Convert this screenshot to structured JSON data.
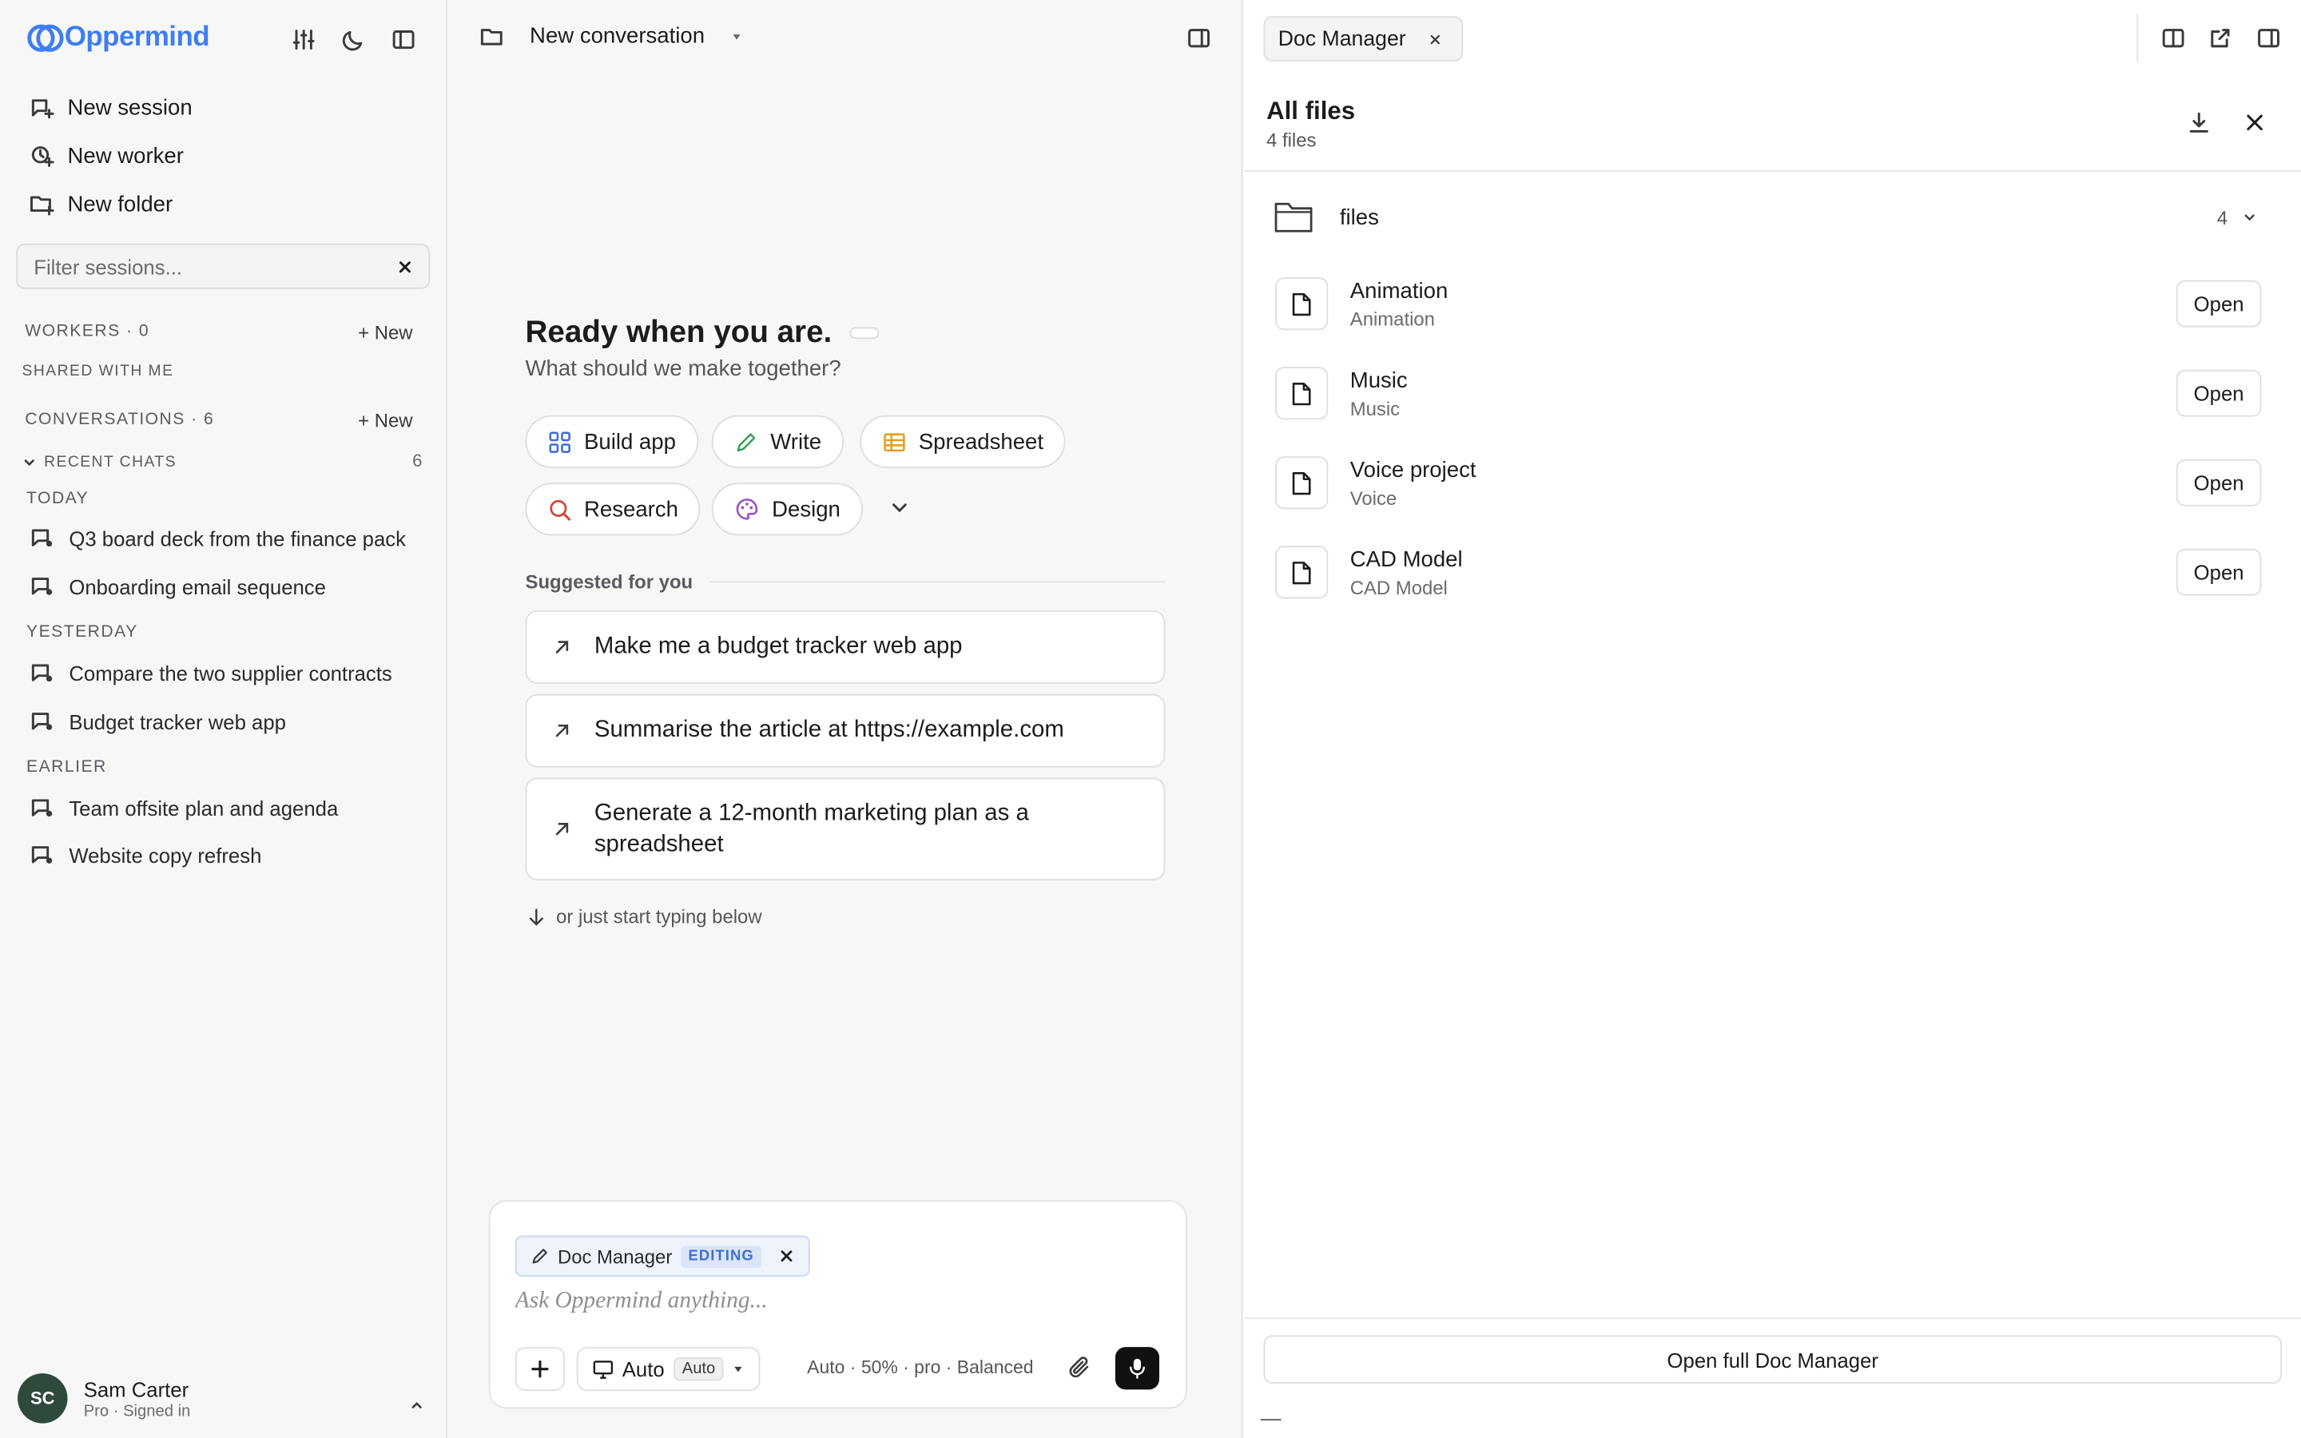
{
  "app": {
    "name": "Oppermind",
    "brand_color": "#3d7ef0"
  },
  "sidebar": {
    "actions": [
      {
        "label": "New session",
        "icon": "new-session-icon"
      },
      {
        "label": "New worker",
        "icon": "new-worker-icon"
      },
      {
        "label": "New folder",
        "icon": "new-folder-icon"
      }
    ],
    "filter_placeholder": "Filter sessions...",
    "workers_label": "WORKERS · 0",
    "workers_new": "+ New",
    "shared_label": "SHARED WITH ME",
    "conversations_label": "CONVERSATIONS · 6",
    "conversations_new": "+ New",
    "recent_label": "RECENT CHATS",
    "recent_count": "6",
    "groups": [
      {
        "label": "TODAY",
        "items": [
          "Q3 board deck from the finance pack",
          "Onboarding email sequence"
        ]
      },
      {
        "label": "YESTERDAY",
        "items": [
          "Compare the two supplier contracts",
          "Budget tracker web app"
        ]
      },
      {
        "label": "EARLIER",
        "items": [
          "Team offsite plan and agenda",
          "Website copy refresh"
        ]
      }
    ],
    "user": {
      "initials": "SC",
      "name": "Sam Carter",
      "status": "Pro · Signed in",
      "avatar_color": "#2f4a3c"
    }
  },
  "center": {
    "title": "New conversation",
    "hero_title": "Ready when you are.",
    "hero_sub": "What should we make together?",
    "chips": [
      {
        "label": "Build app",
        "icon": "grid-icon",
        "color": "#3d6fd6"
      },
      {
        "label": "Write",
        "icon": "pencil-icon",
        "color": "#3aa35a"
      },
      {
        "label": "Spreadsheet",
        "icon": "table-icon",
        "color": "#e0a020"
      },
      {
        "label": "Research",
        "icon": "search-icon",
        "color": "#d0453a"
      },
      {
        "label": "Design",
        "icon": "palette-icon",
        "color": "#9b4fc8"
      }
    ],
    "suggested_label": "Suggested for you",
    "suggestions": [
      "Make me a budget tracker web app",
      "Summarise the article at https://example.com",
      "Generate a 12-month marketing plan as a spreadsheet"
    ],
    "hint": "or just start typing below",
    "composer": {
      "tag_label": "Doc Manager",
      "tag_badge": "EDITING",
      "placeholder": "Ask Oppermind anything...",
      "mode_label": "Auto",
      "mode_badge": "Auto",
      "status": "Auto · 50% · pro · Balanced"
    }
  },
  "right": {
    "tab_label": "Doc Manager",
    "title": "All files",
    "subtitle": "4 files",
    "folder": {
      "name": "files",
      "count": "4"
    },
    "files": [
      {
        "name": "Animation",
        "type": "Animation",
        "action": "Open"
      },
      {
        "name": "Music",
        "type": "Music",
        "action": "Open"
      },
      {
        "name": "Voice project",
        "type": "Voice",
        "action": "Open"
      },
      {
        "name": "CAD Model",
        "type": "CAD Model",
        "action": "Open"
      }
    ],
    "full_button": "Open full Doc Manager",
    "footer_dash": "—"
  }
}
